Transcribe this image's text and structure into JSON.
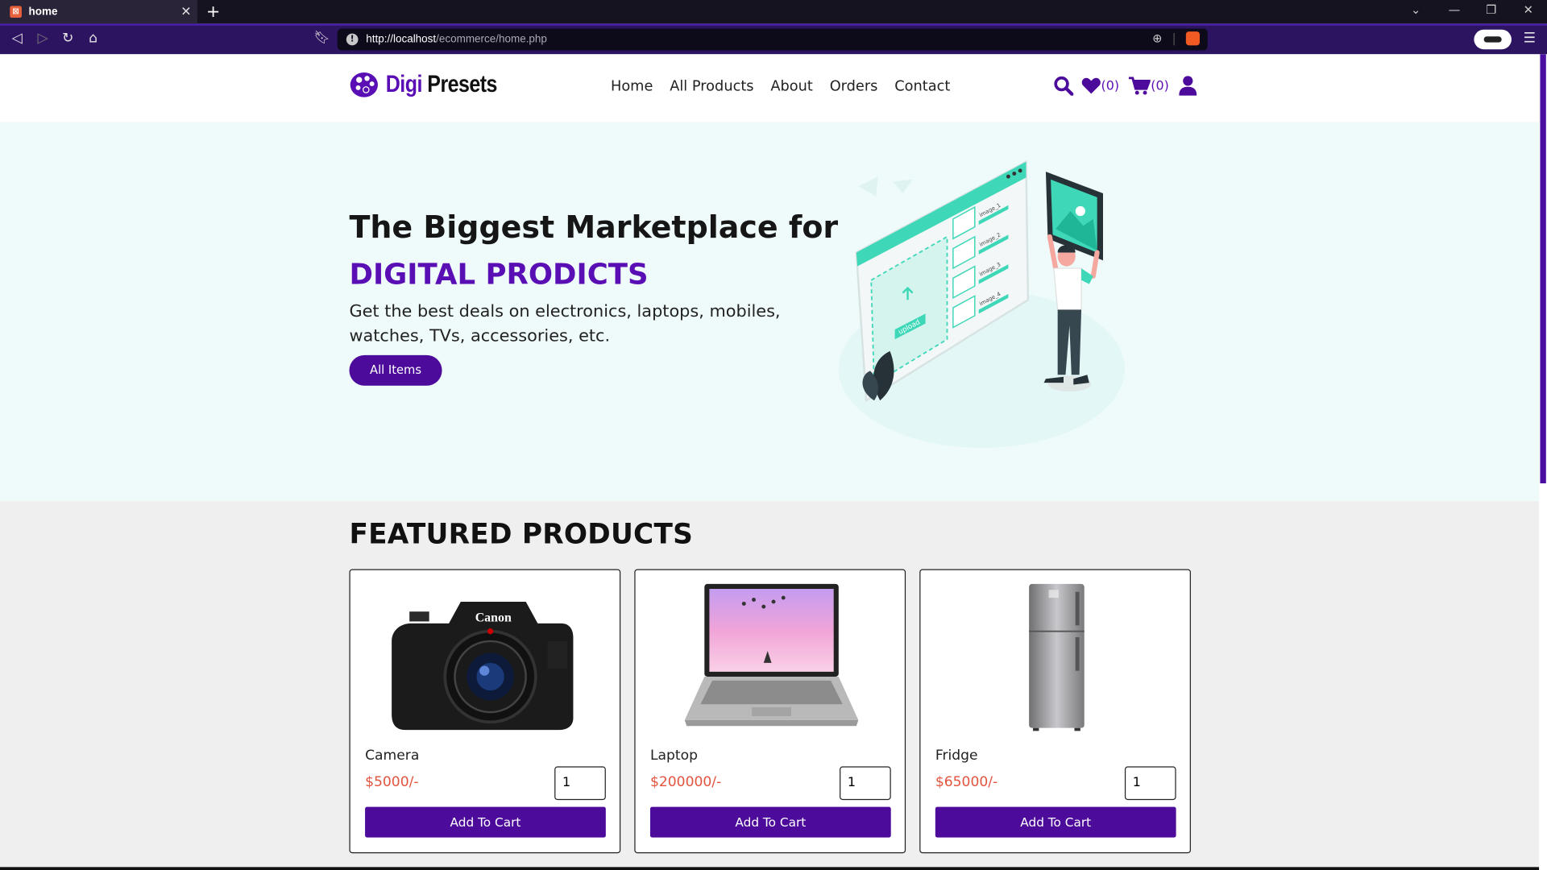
{
  "browser": {
    "tab_title": "home",
    "tab_favicon": "xampp-favicon",
    "url_host": "http://localhost",
    "url_path": "/ecommerce/home.php"
  },
  "header": {
    "logo_part1": "Digi",
    "logo_part2": "Presets",
    "nav": [
      "Home",
      "All Products",
      "About",
      "Orders",
      "Contact"
    ],
    "wishlist_count": "(0)",
    "cart_count": "(0)"
  },
  "hero": {
    "title": "The Biggest Marketplace for",
    "highlight": "DIGITAL PRODICTS",
    "description": "Get the best deals on electronics, laptops, mobiles, watches, TVs, accessories, etc.",
    "button": "All Items"
  },
  "featured": {
    "title": "FEATURED PRODUCTS",
    "products": [
      {
        "name": "Camera",
        "price": "$5000/-",
        "qty": "1",
        "button": "Add To Cart",
        "image": "camera-image"
      },
      {
        "name": "Laptop",
        "price": "$200000/-",
        "qty": "1",
        "button": "Add To Cart",
        "image": "laptop-image"
      },
      {
        "name": "Fridge",
        "price": "$65000/-",
        "qty": "1",
        "button": "Add To Cart",
        "image": "fridge-image"
      }
    ]
  },
  "colors": {
    "brand_purple": "#5a0fb5",
    "button_purple": "#4d0b9c",
    "price_red": "#e2533d",
    "hero_bg": "#effafa",
    "accent_teal": "#3ed8b8"
  },
  "illustration": {
    "labels": [
      "image_1",
      "image_2",
      "image_3",
      "image_4"
    ],
    "upload_label": "upload"
  },
  "camera_brand": "Canon"
}
